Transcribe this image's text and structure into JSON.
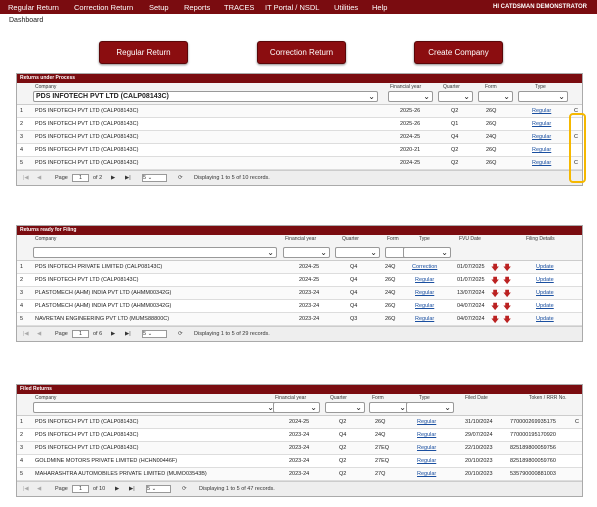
{
  "menu": [
    "Regular Return",
    "Correction Return",
    "Setup",
    "Reports",
    "TRACES",
    "IT Portal / NSDL",
    "Utilities",
    "Help"
  ],
  "user": "HI CATDSMAN DEMONSTRATOR",
  "breadcrumb": "Dashboard",
  "buttons": {
    "regular": "Regular Return",
    "correction": "Correction Return",
    "create": "Create Company"
  },
  "process": {
    "title": "Returns under Process",
    "headers": {
      "company": "Company",
      "fy": "Financial year",
      "quarter": "Quarter",
      "form": "Form",
      "type": "Type"
    },
    "company_filter": "PDS INFOTECH PVT LTD (CALP08143C)",
    "rows": [
      {
        "n": "1",
        "company": "PDS INFOTECH PVT LTD (CALP08143C)",
        "fy": "2025-26",
        "q": "Q2",
        "form": "26Q",
        "type": "Regular",
        "c": "C"
      },
      {
        "n": "2",
        "company": "PDS INFOTECH PVT LTD (CALP08143C)",
        "fy": "2025-26",
        "q": "Q1",
        "form": "26Q",
        "type": "Regular",
        "c": ""
      },
      {
        "n": "3",
        "company": "PDS INFOTECH PVT LTD (CALP08143C)",
        "fy": "2024-25",
        "q": "Q4",
        "form": "24Q",
        "type": "Regular",
        "c": "C"
      },
      {
        "n": "4",
        "company": "PDS INFOTECH PVT LTD (CALP08143C)",
        "fy": "2020-21",
        "q": "Q2",
        "form": "26Q",
        "type": "Regular",
        "c": ""
      },
      {
        "n": "5",
        "company": "PDS INFOTECH PVT LTD (CALP08143C)",
        "fy": "2024-25",
        "q": "Q2",
        "form": "26Q",
        "type": "Regular",
        "c": "C"
      }
    ],
    "pager": {
      "page": "Page",
      "cur": "1",
      "of": "of 2",
      "size": "5",
      "info": "Displaying 1 to 5 of 10 records."
    }
  },
  "ready": {
    "title": "Returns ready for Filing",
    "headers": {
      "company": "Company",
      "fy": "Financial year",
      "quarter": "Quarter",
      "form": "Form",
      "type": "Type",
      "fvu": "FVU Date",
      "details": "Filing Details"
    },
    "rows": [
      {
        "n": "1",
        "company": "PDS INFOTECH PRIVATE LIMITED (CALP08143C)",
        "fy": "2024-25",
        "q": "Q4",
        "form": "24Q",
        "type": "Correction",
        "fvu": "01/07/2025",
        "act": "Update"
      },
      {
        "n": "2",
        "company": "PDS INFOTECH PVT LTD (CALP08143C)",
        "fy": "2024-25",
        "q": "Q4",
        "form": "26Q",
        "type": "Regular",
        "fvu": "01/07/2025",
        "act": "Update"
      },
      {
        "n": "3",
        "company": "PLASTOMECH (AHM) INDIA PVT LTD (AHMM00342G)",
        "fy": "2023-24",
        "q": "Q4",
        "form": "24Q",
        "type": "Regular",
        "fvu": "13/07/2024",
        "act": "Update"
      },
      {
        "n": "4",
        "company": "PLASTOMECH (AHM) INDIA PVT LTD (AHMM00342G)",
        "fy": "2023-24",
        "q": "Q4",
        "form": "26Q",
        "type": "Regular",
        "fvu": "04/07/2024",
        "act": "Update"
      },
      {
        "n": "5",
        "company": "NAVRETAN ENGINEERING PVT LTD (MUMS88800C)",
        "fy": "2023-24",
        "q": "Q3",
        "form": "26Q",
        "type": "Regular",
        "fvu": "04/07/2024",
        "act": "Update"
      }
    ],
    "pager": {
      "page": "Page",
      "cur": "1",
      "of": "of 6",
      "size": "5",
      "info": "Displaying 1 to 5 of 29 records."
    }
  },
  "filed": {
    "title": "Filed Returns",
    "headers": {
      "company": "Company",
      "fy": "Financial year",
      "quarter": "Quarter",
      "form": "Form",
      "type": "Type",
      "filed": "Filed Date",
      "token": "Token / RRR No."
    },
    "rows": [
      {
        "n": "1",
        "company": "PDS INFOTECH PVT LTD (CALP08143C)",
        "fy": "2024-25",
        "q": "Q2",
        "form": "26Q",
        "type": "Regular",
        "date": "31/10/2024",
        "token": "770000269935175",
        "c": "C"
      },
      {
        "n": "2",
        "company": "PDS INFOTECH PVT LTD (CALP08143C)",
        "fy": "2023-24",
        "q": "Q4",
        "form": "24Q",
        "type": "Regular",
        "date": "29/07/2024",
        "token": "770000195170920",
        "c": ""
      },
      {
        "n": "3",
        "company": "PDS INFOTECH PVT LTD (CALP08143C)",
        "fy": "2023-24",
        "q": "Q2",
        "form": "27EQ",
        "type": "Regular",
        "date": "22/10/2023",
        "token": "825189800059756",
        "c": ""
      },
      {
        "n": "4",
        "company": "GOLDMINE MOTORS PRIVATE LIMITED (HCHN00446F)",
        "fy": "2023-24",
        "q": "Q2",
        "form": "27EQ",
        "type": "Regular",
        "date": "20/10/2023",
        "token": "825189800059760",
        "c": ""
      },
      {
        "n": "5",
        "company": "MAHARASHTRA AUTOMOBILES PRIVATE LIMITED (MUMO03543B)",
        "fy": "2023-24",
        "q": "Q2",
        "form": "27Q",
        "type": "Regular",
        "date": "20/10/2023",
        "token": "535790000881003",
        "c": ""
      }
    ],
    "pager": {
      "page": "Page",
      "cur": "1",
      "of": "of 10",
      "size": "5",
      "info": "Displaying 1 to 5 of 47 records."
    }
  }
}
